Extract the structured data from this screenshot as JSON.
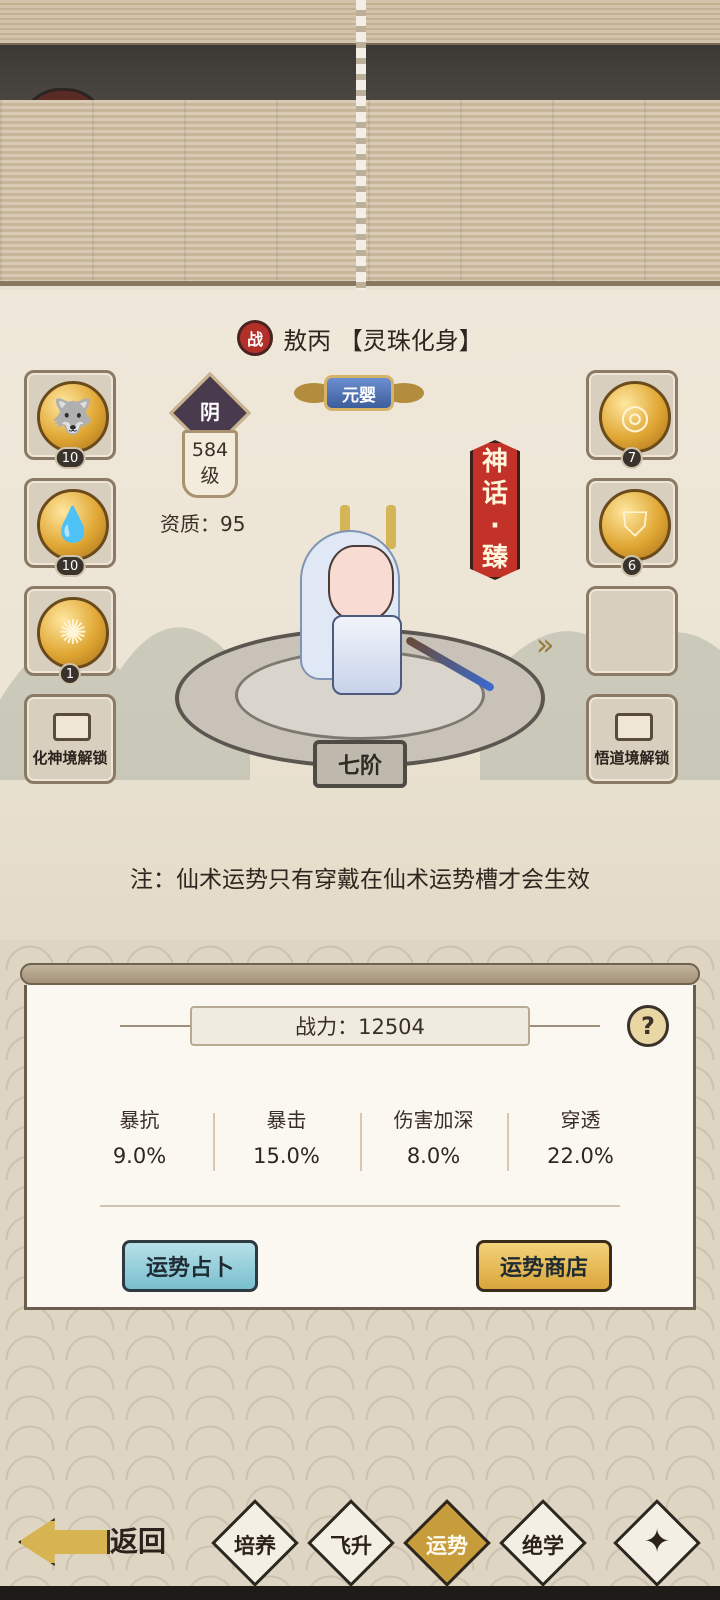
{
  "character": {
    "war_badge": "战",
    "name": "敖丙 【灵珠化身】",
    "realm": "元婴",
    "yin_badge": "阴",
    "level_value": "584",
    "level_unit": "级",
    "aptitude": "资质：95",
    "rarity_chars": [
      "神",
      "话",
      "·",
      "臻"
    ],
    "stage": "七阶"
  },
  "left_slots": [
    {
      "icon": "wolf-emblem-icon",
      "count": "10"
    },
    {
      "icon": "honey-drop-icon",
      "count": "10"
    },
    {
      "icon": "vortex-icon",
      "count": "1"
    },
    {
      "locked_label": "化神境解锁"
    }
  ],
  "right_slots": [
    {
      "icon": "swirl-emblem-icon",
      "count": "7"
    },
    {
      "icon": "helmet-icon",
      "count": "6"
    },
    {
      "empty": true
    },
    {
      "locked_label": "悟道境解锁"
    }
  ],
  "note": "注：仙术运势只有穿戴在仙术运势槽才会生效",
  "panel": {
    "power": "战力：12504",
    "help": "?",
    "stats": [
      {
        "label": "暴抗",
        "value": "9.0%"
      },
      {
        "label": "暴击",
        "value": "15.0%"
      },
      {
        "label": "伤害加深",
        "value": "8.0%"
      },
      {
        "label": "穿透",
        "value": "22.0%"
      }
    ],
    "divine_button": "运势占卜",
    "shop_button": "运势商店"
  },
  "nav": {
    "back_label": "返回",
    "tabs": [
      {
        "label": "培养",
        "active": false
      },
      {
        "label": "飞升",
        "active": false
      },
      {
        "label": "运势",
        "active": true
      },
      {
        "label": "绝学",
        "active": false
      }
    ],
    "extra_tab_icon": "four-point-star-icon"
  },
  "colors": {
    "accent_gold": "#c79c3b",
    "badge_red": "#b3302a",
    "divine_button": "#79bfcf",
    "shop_button": "#d9a43a"
  }
}
